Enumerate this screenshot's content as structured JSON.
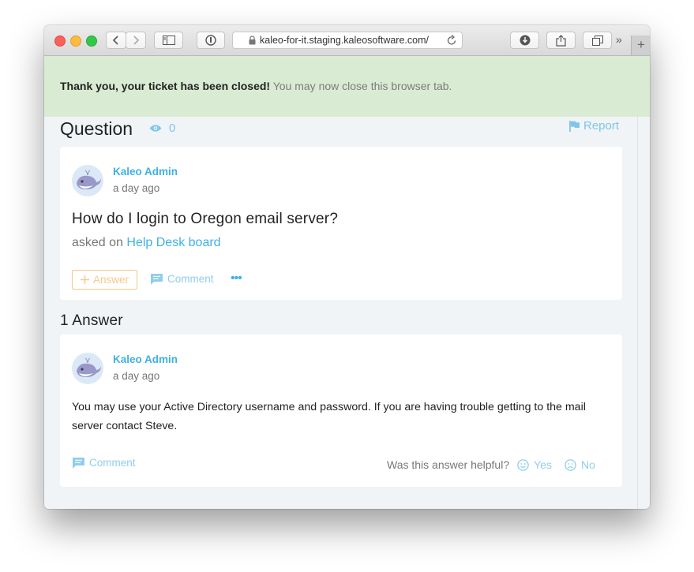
{
  "browser": {
    "url": "kaleo-for-it.staging.kaleosoftware.com/",
    "overflow_glyph": "»",
    "new_tab_glyph": "+"
  },
  "banner": {
    "strong": "Thank you, your ticket has been closed!",
    "text": " You may now close this browser tab."
  },
  "question": {
    "heading": "Question",
    "view_count": "0",
    "report_label": "Report",
    "author": "Kaleo Admin",
    "time": "a day ago",
    "title": "How do I login to Oregon email server?",
    "asked_prefix": "asked on ",
    "board": "Help Desk board",
    "answer_label": "Answer",
    "comment_label": "Comment",
    "more_glyph": "•••"
  },
  "answers": {
    "heading": "1 Answer",
    "items": [
      {
        "author": "Kaleo Admin",
        "time": "a day ago",
        "body": "You may use your Active Directory username and password. If you are having trouble getting to the mail server contact Steve.",
        "comment_label": "Comment",
        "helpful_prompt": "Was this answer helpful?",
        "yes_label": "Yes",
        "no_label": "No"
      }
    ]
  },
  "icons": {
    "views": "eye-icon",
    "report": "flag-icon",
    "comment": "comment-bubble-icon",
    "answer": "plus-icon",
    "smile": "smile-icon",
    "frown": "frown-icon",
    "avatar": "whale-avatar"
  },
  "colors": {
    "accent": "#3fb0e3",
    "accent_light": "#7fc5ea",
    "banner_bg": "#d9ecd3",
    "answer_orange": "#f6c98a",
    "page_bg": "#f1f4f7"
  }
}
